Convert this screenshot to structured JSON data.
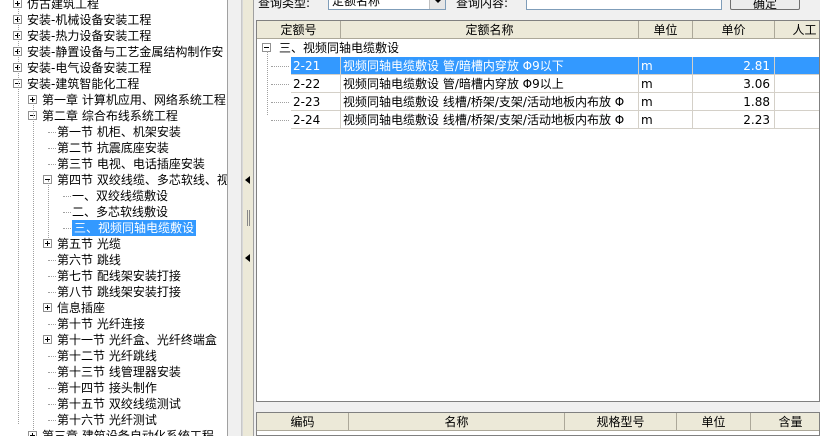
{
  "tree": {
    "items": [
      {
        "label": "仿古建筑工程",
        "expander": "plus"
      },
      {
        "label": "安装-机械设备安装工程",
        "expander": "plus"
      },
      {
        "label": "安装-热力设备安装工程",
        "expander": "plus"
      },
      {
        "label": "安装-静置设备与工艺金属结构制作安",
        "expander": "plus"
      },
      {
        "label": "安装-电气设备安装工程",
        "expander": "plus"
      },
      {
        "label": "安装-建筑智能化工程",
        "expander": "minus"
      },
      {
        "label": "第一章 计算机应用、网络系统工程",
        "expander": "plus"
      },
      {
        "label": "第二章 综合布线系统工程",
        "expander": "minus"
      },
      {
        "label": "第一节 机柜、机架安装",
        "expander": ""
      },
      {
        "label": "第二节 抗震底座安装",
        "expander": ""
      },
      {
        "label": "第三节 电视、电话插座安装",
        "expander": ""
      },
      {
        "label": "第四节 双绞线缆、多芯软线、视",
        "expander": "minus"
      },
      {
        "label": "一、双绞线缆敷设",
        "expander": ""
      },
      {
        "label": "二、多芯软线敷设",
        "expander": ""
      },
      {
        "label": "三、视频同轴电缆敷设",
        "expander": "",
        "selected": true
      },
      {
        "label": "第五节 光缆",
        "expander": "plus"
      },
      {
        "label": "第六节 跳线",
        "expander": ""
      },
      {
        "label": "第七节 配线架安装打接",
        "expander": ""
      },
      {
        "label": "第八节 跳线架安装打接",
        "expander": ""
      },
      {
        "label": "信息插座",
        "expander": "plus"
      },
      {
        "label": "第十节 光纤连接",
        "expander": ""
      },
      {
        "label": "第十一节 光纤盒、光纤终端盒",
        "expander": "plus"
      },
      {
        "label": "第十二节 光纤跳线",
        "expander": ""
      },
      {
        "label": "第十三节 线管理器安装",
        "expander": ""
      },
      {
        "label": "第十四节 接头制作",
        "expander": ""
      },
      {
        "label": "第十五节 双绞线缆测试",
        "expander": ""
      },
      {
        "label": "第十六节 光纤测试",
        "expander": ""
      },
      {
        "label": "第三章 建筑设备自动化系统工程",
        "expander": "plus"
      }
    ]
  },
  "query": {
    "type_label": "查询类型:",
    "type_value": "定额名称",
    "content_label": "查询内容:",
    "content_value": "",
    "confirm": "确定"
  },
  "grid": {
    "headers": [
      "定额号",
      "定额名称",
      "单位",
      "单价",
      "人工"
    ],
    "group": "三、视频同轴电缆敷设",
    "rows": [
      {
        "code": "2-21",
        "name": "视频同轴电缆敷设 管/暗槽内穿放 Φ9以下",
        "unit": "m",
        "price": "2.81",
        "selected": true
      },
      {
        "code": "2-22",
        "name": "视频同轴电缆敷设 管/暗槽内穿放 Φ9以上",
        "unit": "m",
        "price": "3.06"
      },
      {
        "code": "2-23",
        "name": "视频同轴电缆敷设 线槽/桥架/支架/活动地板内布放 Φ",
        "unit": "m",
        "price": "1.88"
      },
      {
        "code": "2-24",
        "name": "视频同轴电缆敷设 线槽/桥架/支架/活动地板内布放 Φ",
        "unit": "m",
        "price": "2.23"
      }
    ]
  },
  "bottom": {
    "headers": [
      "编码",
      "名称",
      "规格型号",
      "单位",
      "含量"
    ]
  }
}
